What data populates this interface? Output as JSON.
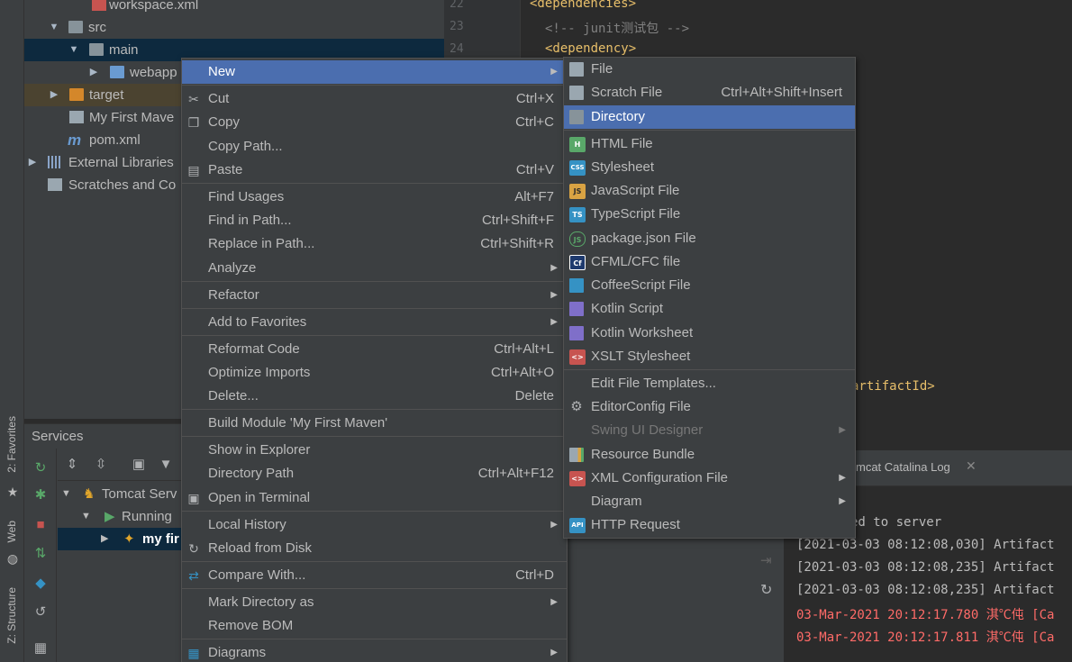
{
  "project_tree": [
    {
      "label": "workspace.xml",
      "icon": "xml-file-icon"
    },
    {
      "label": "src",
      "icon": "folder-icon"
    },
    {
      "label": "main",
      "icon": "folder-icon"
    },
    {
      "label": "webapp",
      "icon": "web-folder-icon"
    },
    {
      "label": "target",
      "icon": "folder-orange-icon"
    },
    {
      "label": "My First Mave",
      "icon": "module-file-icon"
    },
    {
      "label": "pom.xml",
      "icon": "maven-icon"
    },
    {
      "label": "External Libraries",
      "icon": "libraries-icon"
    },
    {
      "label": "Scratches and Co",
      "icon": "scratches-icon"
    }
  ],
  "editor": {
    "line_numbers": [
      "22",
      "23",
      "24"
    ],
    "lines": [
      "<dependencies>",
      "<!-- junit测试包 -->",
      "<dependency>"
    ],
    "fragment": "artifactId>"
  },
  "left_strip": {
    "favorites": "2: Favorites",
    "web": "Web",
    "structure": "Z: Structure"
  },
  "services": {
    "title": "Services",
    "rows": [
      "Tomcat Serv",
      "Running",
      "my fir"
    ]
  },
  "log": {
    "tab": "mcat Catalina Log",
    "lines": [
      "ed to server",
      "[2021-03-03 08:12:08,030] Artifact",
      "[2021-03-03 08:12:08,235] Artifact",
      "[2021-03-03 08:12:08,235] Artifact",
      "03-Mar-2021 20:12:17.780 淇℃伅 [Ca",
      "03-Mar-2021 20:12:17.811 淇℃伅 [Ca"
    ]
  },
  "context_menu": {
    "items": [
      {
        "label": "New",
        "shortcut": "",
        "submenu": true
      },
      {
        "label": "Cut",
        "shortcut": "Ctrl+X"
      },
      {
        "label": "Copy",
        "shortcut": "Ctrl+C"
      },
      {
        "label": "Copy Path...",
        "shortcut": ""
      },
      {
        "label": "Paste",
        "shortcut": "Ctrl+V"
      },
      {
        "label": "Find Usages",
        "shortcut": "Alt+F7"
      },
      {
        "label": "Find in Path...",
        "shortcut": "Ctrl+Shift+F"
      },
      {
        "label": "Replace in Path...",
        "shortcut": "Ctrl+Shift+R"
      },
      {
        "label": "Analyze",
        "shortcut": "",
        "submenu": true
      },
      {
        "label": "Refactor",
        "shortcut": "",
        "submenu": true
      },
      {
        "label": "Add to Favorites",
        "shortcut": "",
        "submenu": true
      },
      {
        "label": "Reformat Code",
        "shortcut": "Ctrl+Alt+L"
      },
      {
        "label": "Optimize Imports",
        "shortcut": "Ctrl+Alt+O"
      },
      {
        "label": "Delete...",
        "shortcut": "Delete"
      },
      {
        "label": "Build Module 'My First Maven'",
        "shortcut": ""
      },
      {
        "label": "Show in Explorer",
        "shortcut": ""
      },
      {
        "label": "Directory Path",
        "shortcut": "Ctrl+Alt+F12"
      },
      {
        "label": "Open in Terminal",
        "shortcut": ""
      },
      {
        "label": "Local History",
        "shortcut": "",
        "submenu": true
      },
      {
        "label": "Reload from Disk",
        "shortcut": ""
      },
      {
        "label": "Compare With...",
        "shortcut": "Ctrl+D"
      },
      {
        "label": "Mark Directory as",
        "shortcut": "",
        "submenu": true
      },
      {
        "label": "Remove BOM",
        "shortcut": ""
      },
      {
        "label": "Diagrams",
        "shortcut": "",
        "submenu": true
      }
    ]
  },
  "new_submenu": {
    "items": [
      {
        "label": "File",
        "shortcut": ""
      },
      {
        "label": "Scratch File",
        "shortcut": "Ctrl+Alt+Shift+Insert"
      },
      {
        "label": "Directory",
        "shortcut": ""
      },
      {
        "label": "HTML File",
        "shortcut": "",
        "badge": "H"
      },
      {
        "label": "Stylesheet",
        "shortcut": "",
        "badge": "CSS"
      },
      {
        "label": "JavaScript File",
        "shortcut": "",
        "badge": "JS"
      },
      {
        "label": "TypeScript File",
        "shortcut": "",
        "badge": "TS"
      },
      {
        "label": "package.json File",
        "shortcut": "",
        "badge": "JS"
      },
      {
        "label": "CFML/CFC file",
        "shortcut": "",
        "badge": "Cf"
      },
      {
        "label": "CoffeeScript File",
        "shortcut": ""
      },
      {
        "label": "Kotlin Script",
        "shortcut": ""
      },
      {
        "label": "Kotlin Worksheet",
        "shortcut": ""
      },
      {
        "label": "XSLT Stylesheet",
        "shortcut": "",
        "badge": "<>"
      },
      {
        "label": "Edit File Templates...",
        "shortcut": ""
      },
      {
        "label": "EditorConfig File",
        "shortcut": ""
      },
      {
        "label": "Swing UI Designer",
        "shortcut": "",
        "submenu": true,
        "disabled": true
      },
      {
        "label": "Resource Bundle",
        "shortcut": ""
      },
      {
        "label": "XML Configuration File",
        "shortcut": "",
        "submenu": true,
        "badge": "<>"
      },
      {
        "label": "Diagram",
        "shortcut": "",
        "submenu": true
      },
      {
        "label": "HTTP Request",
        "shortcut": "",
        "badge": "API"
      }
    ]
  },
  "colors": {
    "menu_bg": "#3c3f41",
    "highlight": "#4b6eaf",
    "editor_bg": "#2b2b2b",
    "tag": "#e8bf6a",
    "error": "#ff6b68"
  }
}
